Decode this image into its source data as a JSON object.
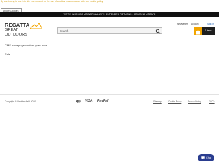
{
  "cookie_banner": {
    "notice": "By continuing to use this site you consent to the use of cookies in accordance with our cookie policy.",
    "allow_button": "Allow Cookies"
  },
  "promo_bar": {
    "text": "WE'RE WORKING AS NORMAL WITH EXTENDED RETURNS - COVID-19 UPDATE"
  },
  "header": {
    "logo_line1": "REGATTA",
    "logo_line2": "GREAT OUTDOORS",
    "search": {
      "placeholder": "Search"
    },
    "newsletter": "Newsletter",
    "account": "Account",
    "sign_in": "Sign in",
    "basket_label": "0 items"
  },
  "main": {
    "cms_text": "CMS homepage content goes here.",
    "sale_text": "Sale"
  },
  "footer": {
    "copyright": "Copyright © Haddersfield 2020",
    "payment_icons": [
      "mastercard-icon",
      "visa-icon",
      "paypal-icon"
    ],
    "visa_label": "VISA",
    "paypal_label": "PayPal",
    "links": [
      "Sitemap",
      "Cookie Policy",
      "Privacy Policy",
      "T&C's"
    ]
  },
  "chat": {
    "label": "Chat"
  },
  "colors": {
    "promo_bg": "#111111",
    "accent_orange": "#f2a500",
    "chat_blue": "#2a3d8f",
    "cookie_text": "#d4a017"
  }
}
